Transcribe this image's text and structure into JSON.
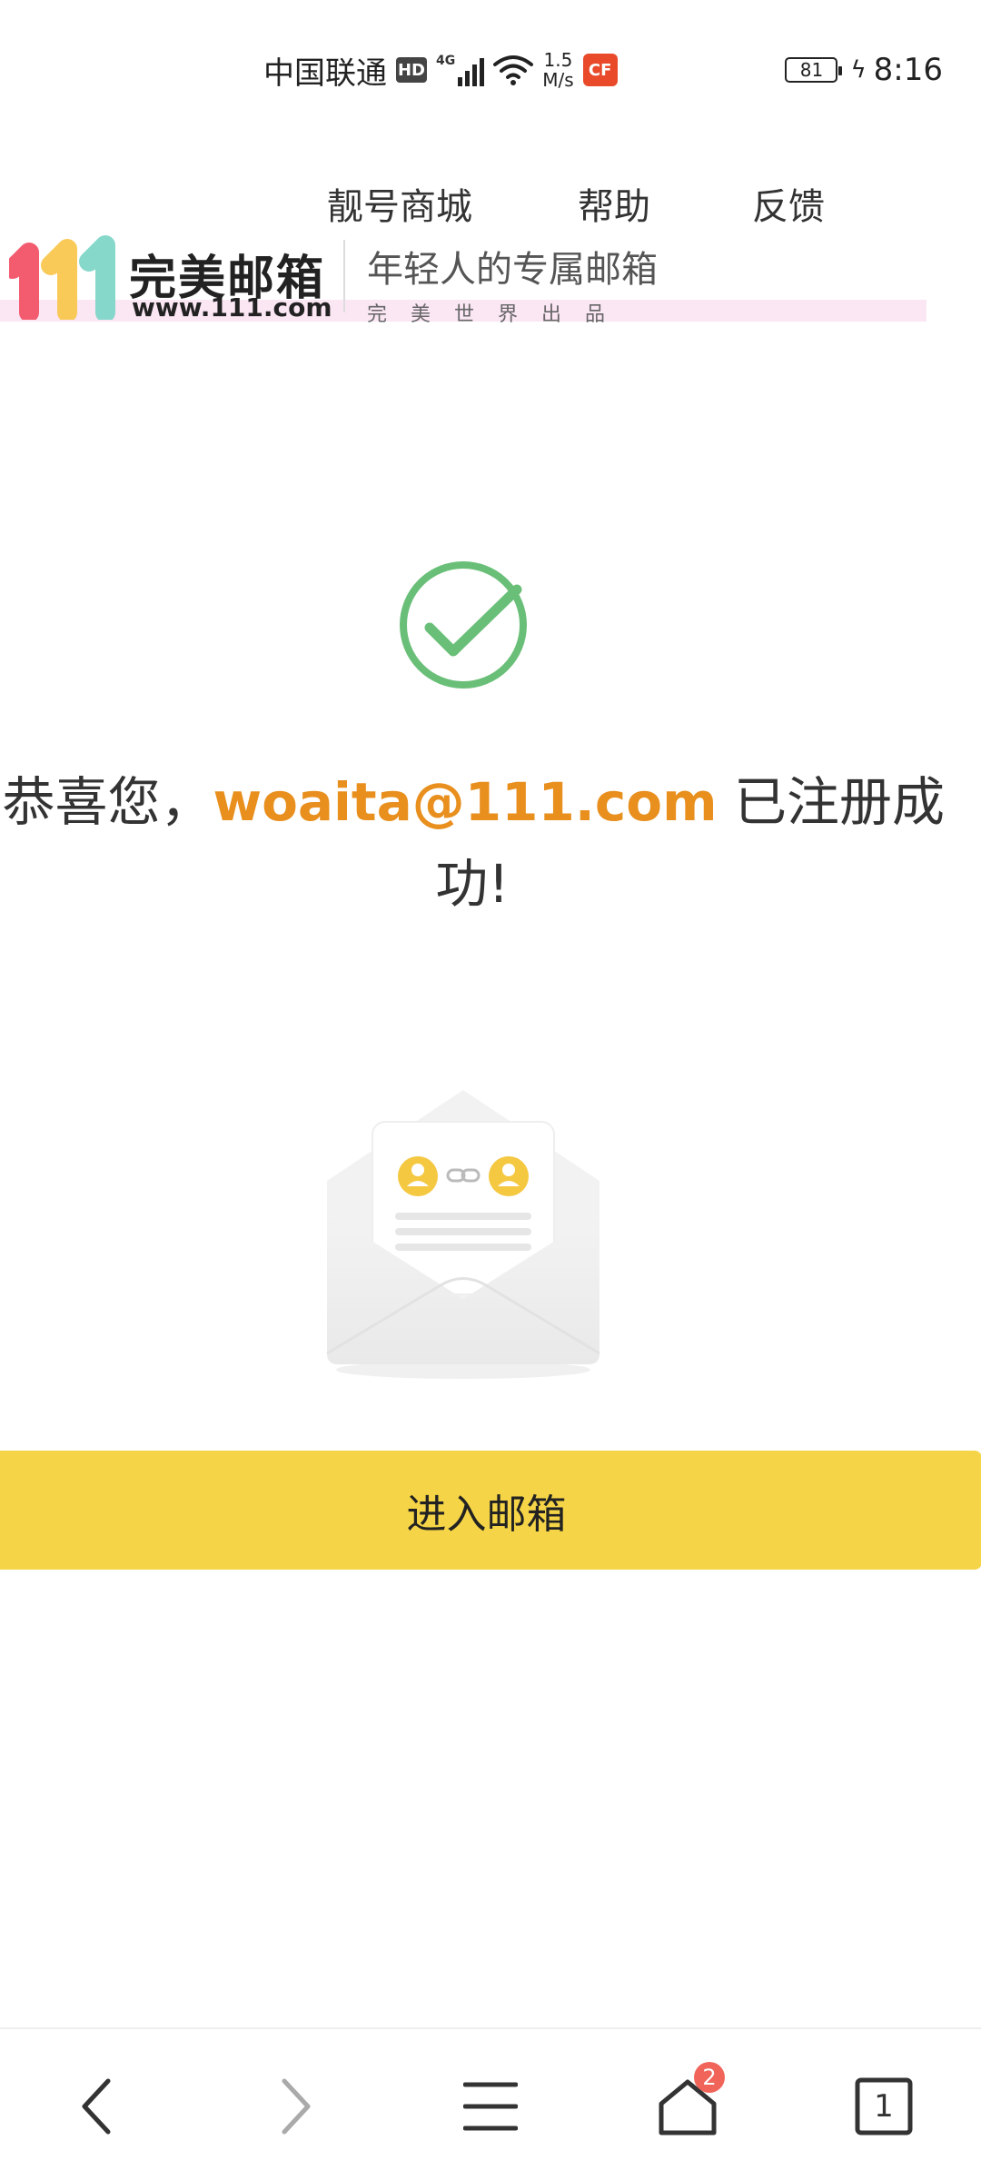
{
  "status_bar": {
    "carrier": "中国联通",
    "hd_label": "HD",
    "network_gen": "4G",
    "speed_value": "1.5",
    "speed_unit": "M/s",
    "battery_level": "81",
    "time": "8:16"
  },
  "top_nav": {
    "items": [
      {
        "label": "靓号商城"
      },
      {
        "label": "帮助"
      },
      {
        "label": "反馈"
      }
    ]
  },
  "banner": {
    "logo_digits": "111",
    "brand_name": "完美邮箱",
    "url": "www.111.com",
    "slogan": "年轻人的专属邮箱",
    "sub_slogan": "完美世界出品",
    "colors": {
      "digit1": "#f25c6e",
      "digit2": "#f9c74f",
      "digit3": "#7fd6c8",
      "strip": "#fbe6f4"
    }
  },
  "success": {
    "prefix": "恭喜您，",
    "email": "woaita@111.com",
    "suffix_line1": " 已注册成",
    "suffix_line2": "功!",
    "icon": "check-circle-icon",
    "icon_color": "#6abf78",
    "email_color": "#e88f1e"
  },
  "illustration": {
    "icon": "envelope-illustration"
  },
  "enter_button": {
    "label": "进入邮箱",
    "color": "#f5d547"
  },
  "bottom_bar": {
    "back_icon": "back-arrow-icon",
    "forward_icon": "forward-arrow-icon",
    "menu_icon": "menu-icon",
    "home_icon": "home-icon",
    "home_badge": "2",
    "tabs_count": "1"
  }
}
